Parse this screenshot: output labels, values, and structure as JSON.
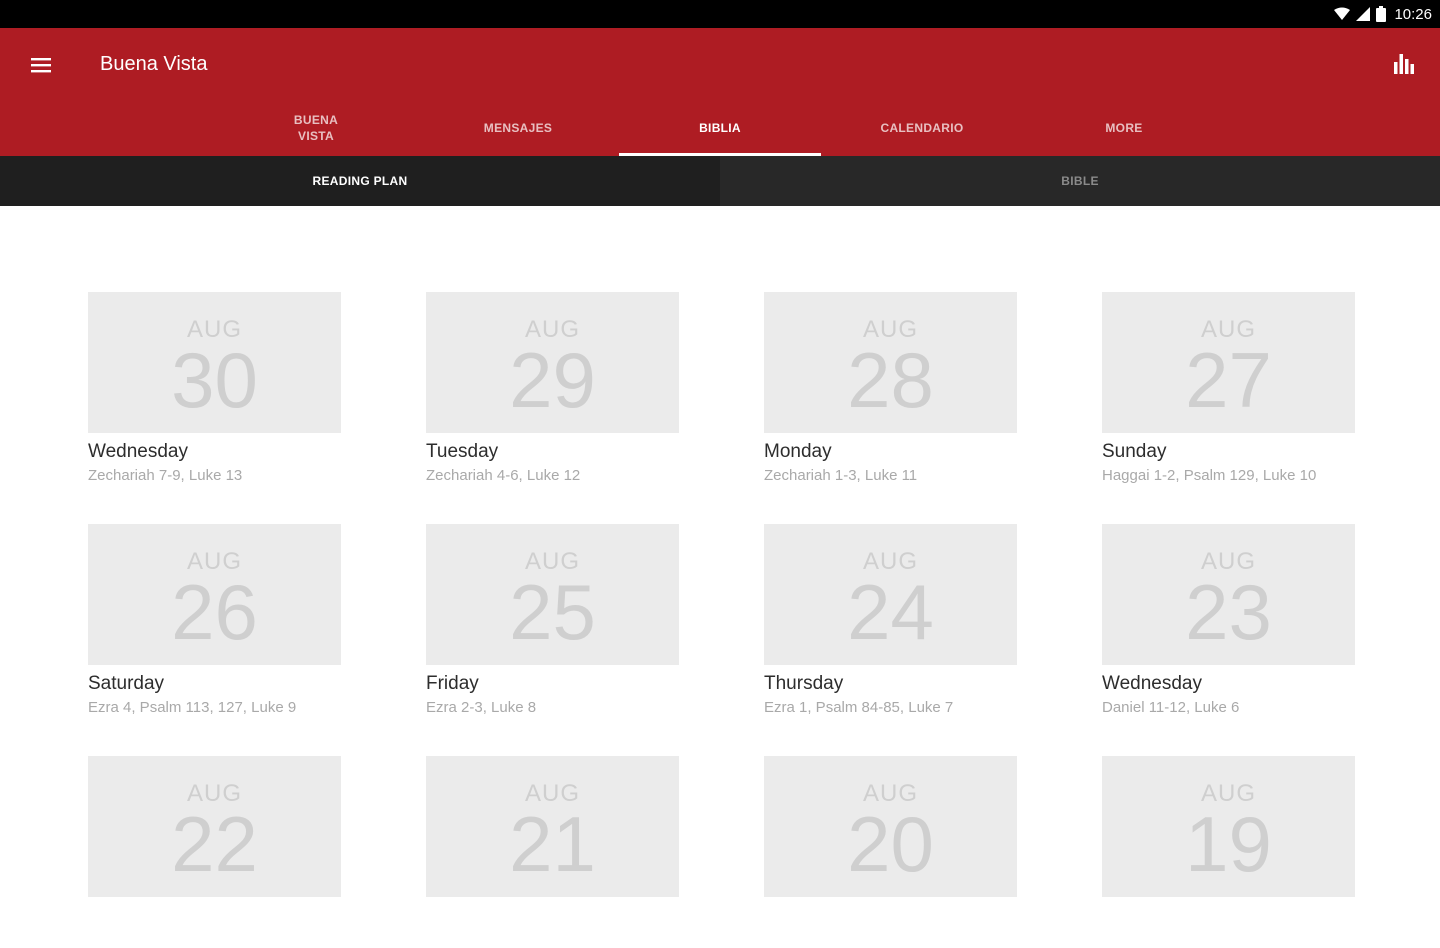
{
  "status_bar": {
    "time": "10:26"
  },
  "app_bar": {
    "title": "Buena Vista"
  },
  "tabs": [
    {
      "label": "BUENA VISTA"
    },
    {
      "label": "MENSAJES"
    },
    {
      "label": "BIBLIA"
    },
    {
      "label": "CALENDARIO"
    },
    {
      "label": "MORE"
    }
  ],
  "sub_tabs": [
    {
      "label": "READING PLAN"
    },
    {
      "label": "BIBLE"
    }
  ],
  "days": [
    {
      "month": "AUG",
      "day": "30",
      "weekday": "Wednesday",
      "readings": "Zechariah 7-9, Luke 13"
    },
    {
      "month": "AUG",
      "day": "29",
      "weekday": "Tuesday",
      "readings": "Zechariah 4-6, Luke 12"
    },
    {
      "month": "AUG",
      "day": "28",
      "weekday": "Monday",
      "readings": "Zechariah 1-3, Luke 11"
    },
    {
      "month": "AUG",
      "day": "27",
      "weekday": "Sunday",
      "readings": "Haggai 1-2, Psalm 129, Luke 10"
    },
    {
      "month": "AUG",
      "day": "26",
      "weekday": "Saturday",
      "readings": "Ezra 4, Psalm 113, 127, Luke 9"
    },
    {
      "month": "AUG",
      "day": "25",
      "weekday": "Friday",
      "readings": "Ezra 2-3, Luke 8"
    },
    {
      "month": "AUG",
      "day": "24",
      "weekday": "Thursday",
      "readings": "Ezra 1, Psalm 84-85, Luke 7"
    },
    {
      "month": "AUG",
      "day": "23",
      "weekday": "Wednesday",
      "readings": "Daniel 11-12, Luke 6"
    },
    {
      "month": "AUG",
      "day": "22",
      "weekday": "",
      "readings": ""
    },
    {
      "month": "AUG",
      "day": "21",
      "weekday": "",
      "readings": ""
    },
    {
      "month": "AUG",
      "day": "20",
      "weekday": "",
      "readings": ""
    },
    {
      "month": "AUG",
      "day": "19",
      "weekday": "",
      "readings": ""
    }
  ],
  "colors": {
    "primary": "#ae1c23",
    "subtab_bg": "#1f1f1f",
    "card_bg": "#ebebeb"
  },
  "icons": {
    "menu": "hamburger-menu-icon",
    "stats": "bar-chart-icon",
    "wifi": "wifi-icon",
    "signal": "signal-icon",
    "battery": "battery-icon"
  }
}
